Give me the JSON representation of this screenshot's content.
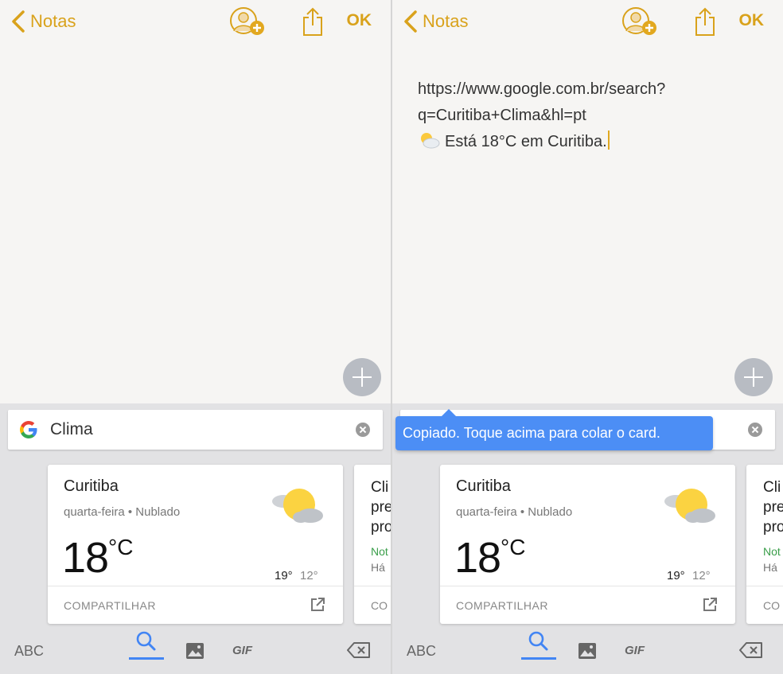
{
  "nav": {
    "back_label": "Notas",
    "ok_label": "OK"
  },
  "note": {
    "line1": "https://www.google.com.br/search?",
    "line2": "q=Curitiba+Clima&hl=pt",
    "line3": "Está 18°C em Curitiba."
  },
  "search": {
    "query": "Clima"
  },
  "weather_card": {
    "city": "Curitiba",
    "subtitle": "quarta-feira • Nublado",
    "temperature": "18",
    "unit": "°C",
    "high": "19°",
    "low": "12°",
    "share_label": "COMPARTILHAR"
  },
  "second_card": {
    "line1": "Cli",
    "line2": "pre",
    "line3": "pro",
    "source": "Not",
    "ago": "Há",
    "share_label": "CO"
  },
  "tooltip": {
    "text": "Copiado. Toque acima para colar o card."
  },
  "keyboard": {
    "abc_label": "ABC",
    "gif_label": "GIF"
  },
  "colors": {
    "accent": "#d9a21b",
    "google_blue": "#4285f4",
    "tooltip_bg": "#4c8ef5"
  }
}
